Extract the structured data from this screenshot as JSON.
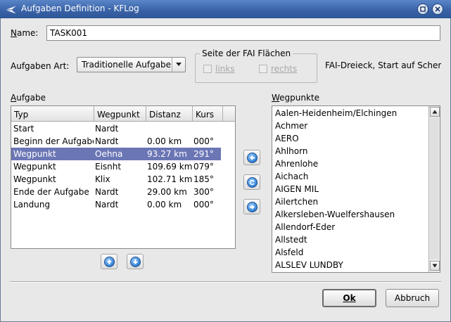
{
  "window": {
    "title": "Aufgaben Definition - KFLog"
  },
  "name": {
    "label": "Name:",
    "value": "TASK001"
  },
  "task_type": {
    "label": "Aufgaben Art:",
    "value": "Traditionelle Aufgabe"
  },
  "fai": {
    "group_title": "Seite der FAI Flächen",
    "left_label": "links",
    "right_label": "rechts",
    "info": "FAI-Dreieck, Start auf Schen"
  },
  "task_list": {
    "label": "Aufgabe",
    "columns": [
      "Typ",
      "Wegpunkt",
      "Distanz",
      "Kurs"
    ],
    "rows": [
      {
        "typ": "Start",
        "wegpunkt": "Nardt",
        "distanz": "",
        "kurs": ""
      },
      {
        "typ": "Beginn der Aufgabe",
        "wegpunkt": "Nardt",
        "distanz": "0.00 km",
        "kurs": "000°"
      },
      {
        "typ": "Wegpunkt",
        "wegpunkt": "Oehna",
        "distanz": "93.27 km",
        "kurs": "291°"
      },
      {
        "typ": "Wegpunkt",
        "wegpunkt": "Eisnht",
        "distanz": "109.69 km",
        "kurs": "079°"
      },
      {
        "typ": "Wegpunkt",
        "wegpunkt": "Klix",
        "distanz": "102.71 km",
        "kurs": "185°"
      },
      {
        "typ": "Ende der Aufgabe",
        "wegpunkt": "Nardt",
        "distanz": "29.00 km",
        "kurs": "300°"
      },
      {
        "typ": "Landung",
        "wegpunkt": "Nardt",
        "distanz": "0.00 km",
        "kurs": "000°"
      }
    ],
    "selected_row": 2
  },
  "waypoints": {
    "label": "Wegpunkte",
    "items": [
      "Aalen-Heidenheim/Elchingen",
      "Achmer",
      "AERO",
      "Ahlhorn",
      "Ahrenlohe",
      "Aichach",
      "AIGEN MIL",
      "Ailertchen",
      "Alkersleben-Wuelfershausen",
      "Allendorf-Eder",
      "Allstedt",
      "Alsfeld",
      "ALSLEV LUNDBY"
    ]
  },
  "buttons": {
    "ok": "Ok",
    "cancel": "Abbruch"
  },
  "colors": {
    "titlebar": "#3a63a8",
    "selection": "#6b76b5",
    "icon_blue": "#2f7fd6"
  }
}
